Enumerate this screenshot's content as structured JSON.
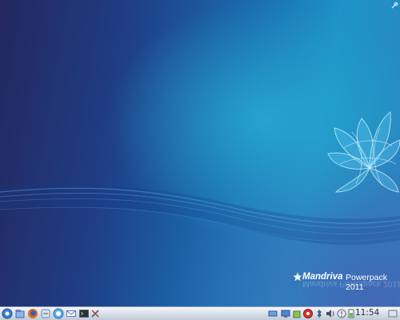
{
  "branding": {
    "name": "Mandriva",
    "edition": "Powerpack 2011",
    "reflection": "Mandriva Powerpack 2011"
  },
  "taskbar": {
    "launchers": [
      "menu-icon",
      "home-folder-icon",
      "firefox-icon",
      "file-manager-icon",
      "chat-icon",
      "mail-icon",
      "terminal-icon",
      "tools-icon"
    ],
    "tray": [
      "devices-icon",
      "network-icon",
      "package-icon",
      "update-icon",
      "bluetooth-icon",
      "volume-icon",
      "notifications-icon",
      "battery-icon"
    ],
    "clock": "11:54"
  },
  "colors": {
    "accent": "#1d93c6",
    "taskbar": "#d4dbe6"
  }
}
